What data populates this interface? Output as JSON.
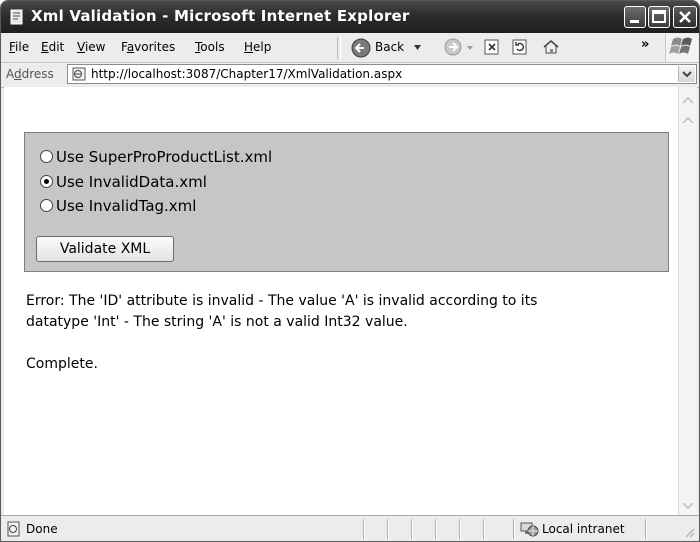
{
  "window": {
    "title": "Xml Validation - Microsoft Internet Explorer"
  },
  "menu": {
    "items": [
      {
        "key": "F",
        "rest": "ile"
      },
      {
        "key": "E",
        "rest": "dit"
      },
      {
        "key": "V",
        "rest": "iew"
      },
      {
        "pre": "F",
        "key": "a",
        "rest": "vorites"
      },
      {
        "key": "T",
        "rest": "ools"
      },
      {
        "key": "H",
        "rest": "elp"
      }
    ],
    "back_label": "Back",
    "overflow": "»"
  },
  "address": {
    "label_pre": "A",
    "label_key": "d",
    "label_rest": "dress",
    "url": "http://localhost:3087/Chapter17/XmlValidation.aspx"
  },
  "form": {
    "options": [
      {
        "label": "Use SuperProProductList.xml",
        "checked": false
      },
      {
        "label": "Use InvalidData.xml",
        "checked": true
      },
      {
        "label": "Use InvalidTag.xml",
        "checked": false
      }
    ],
    "validate_button": "Validate XML"
  },
  "output": {
    "error_line1": "Error: The 'ID' attribute is invalid - The value 'A' is invalid according to its",
    "error_line2": "datatype 'Int' - The string 'A' is not a valid Int32 value.",
    "complete": "Complete."
  },
  "status": {
    "text": "Done",
    "zone": "Local intranet"
  }
}
